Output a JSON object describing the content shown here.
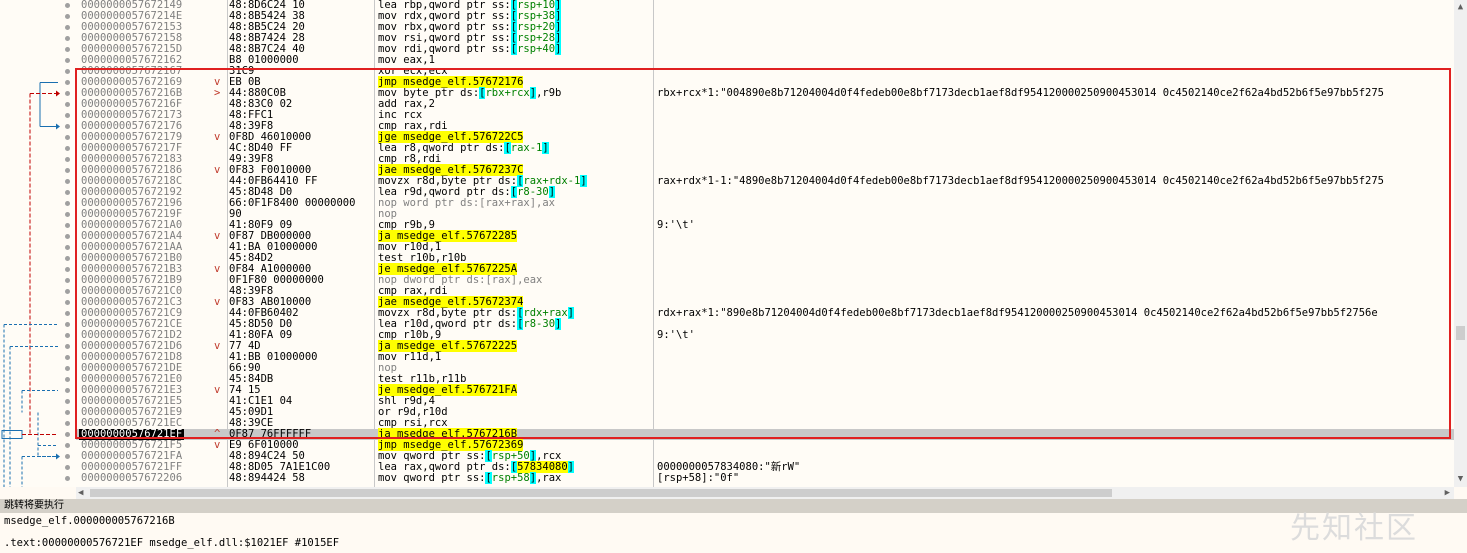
{
  "rows": [
    {
      "addr": "0000000057672149",
      "bytes": "48:8D6C24 10",
      "instr": [
        {
          "t": "lea rbp,qword ptr ss:"
        },
        {
          "t": "[",
          "c": "bracket"
        },
        {
          "t": "rsp+10",
          "c": "reg"
        },
        {
          "t": "]",
          "c": "bracket"
        }
      ],
      "comment": ""
    },
    {
      "addr": "000000005767214E",
      "bytes": "48:8B5424 38",
      "instr": [
        {
          "t": "mov rdx,qword ptr ss:"
        },
        {
          "t": "[",
          "c": "bracket"
        },
        {
          "t": "rsp+38",
          "c": "reg"
        },
        {
          "t": "]",
          "c": "bracket"
        }
      ],
      "comment": ""
    },
    {
      "addr": "0000000057672153",
      "bytes": "48:8B5C24 20",
      "instr": [
        {
          "t": "mov rbx,qword ptr ss:"
        },
        {
          "t": "[",
          "c": "bracket"
        },
        {
          "t": "rsp+20",
          "c": "reg"
        },
        {
          "t": "]",
          "c": "bracket"
        }
      ],
      "comment": ""
    },
    {
      "addr": "0000000057672158",
      "bytes": "48:8B7424 28",
      "instr": [
        {
          "t": "mov rsi,qword ptr ss:"
        },
        {
          "t": "[",
          "c": "bracket"
        },
        {
          "t": "rsp+28",
          "c": "reg"
        },
        {
          "t": "]",
          "c": "bracket"
        }
      ],
      "comment": ""
    },
    {
      "addr": "000000005767215D",
      "bytes": "48:8B7C24 40",
      "instr": [
        {
          "t": "mov rdi,qword ptr ss:"
        },
        {
          "t": "[",
          "c": "bracket"
        },
        {
          "t": "rsp+40",
          "c": "reg"
        },
        {
          "t": "]",
          "c": "bracket"
        }
      ],
      "comment": ""
    },
    {
      "addr": "0000000057672162",
      "bytes": "B8 01000000",
      "instr": [
        {
          "t": "mov eax,1"
        }
      ],
      "comment": ""
    },
    {
      "addr": "0000000057672167",
      "bytes": "31C9",
      "instr": [
        {
          "t": "xor ecx,ecx"
        }
      ],
      "comment": ""
    },
    {
      "addr": "0000000057672169",
      "flag": "v",
      "bytes": "EB 0B",
      "instr": [
        {
          "t": "jmp msedge_elf.57672176",
          "c": "jmp"
        }
      ],
      "comment": ""
    },
    {
      "addr": "000000005767216B",
      "flag": ">",
      "bytes": "44:880C0B",
      "instr": [
        {
          "t": "mov byte ptr ds:"
        },
        {
          "t": "[",
          "c": "bracket"
        },
        {
          "t": "rbx+rcx",
          "c": "reg"
        },
        {
          "t": "]",
          "c": "bracket"
        },
        {
          "t": ",r9b"
        }
      ],
      "comment": "rbx+rcx*1:\"004890e8b71204004d0f4fedeb00e8bf7173decb1aef8df954120000250900453014 0c4502140ce2f62a4bd52b6f5e97bb5f275"
    },
    {
      "addr": "000000005767216F",
      "bytes": "48:83C0 02",
      "instr": [
        {
          "t": "add rax,2"
        }
      ],
      "comment": ""
    },
    {
      "addr": "0000000057672173",
      "bytes": "48:FFC1",
      "instr": [
        {
          "t": "inc rcx"
        }
      ],
      "comment": ""
    },
    {
      "addr": "0000000057672176",
      "bytes": "48:39F8",
      "instr": [
        {
          "t": "cmp rax,rdi"
        }
      ],
      "comment": ""
    },
    {
      "addr": "0000000057672179",
      "flag": "v",
      "bytes": "0F8D 46010000",
      "instr": [
        {
          "t": "jge msedge_elf.576722C5",
          "c": "jmp"
        }
      ],
      "comment": ""
    },
    {
      "addr": "000000005767217F",
      "bytes": "4C:8D40 FF",
      "instr": [
        {
          "t": "lea r8,qword ptr ds:"
        },
        {
          "t": "[",
          "c": "bracket"
        },
        {
          "t": "rax-1",
          "c": "reg"
        },
        {
          "t": "]",
          "c": "bracket"
        }
      ],
      "comment": ""
    },
    {
      "addr": "0000000057672183",
      "bytes": "49:39F8",
      "instr": [
        {
          "t": "cmp r8,rdi"
        }
      ],
      "comment": ""
    },
    {
      "addr": "0000000057672186",
      "flag": "v",
      "bytes": "0F83 F0010000",
      "instr": [
        {
          "t": "jae msedge_elf.5767237C",
          "c": "jmp"
        }
      ],
      "comment": ""
    },
    {
      "addr": "000000005767218C",
      "bytes": "44:0FB64410 FF",
      "instr": [
        {
          "t": "movzx r8d,byte ptr ds:"
        },
        {
          "t": "[",
          "c": "bracket"
        },
        {
          "t": "rax+rdx-1",
          "c": "reg"
        },
        {
          "t": "]",
          "c": "bracket"
        }
      ],
      "comment": "rax+rdx*1-1:\"4890e8b71204004d0f4fedeb00e8bf7173decb1aef8df954120000250900453014 0c4502140ce2f62a4bd52b6f5e97bb5f275"
    },
    {
      "addr": "0000000057672192",
      "bytes": "45:8D48 D0",
      "instr": [
        {
          "t": "lea r9d,qword ptr ds:"
        },
        {
          "t": "[",
          "c": "bracket"
        },
        {
          "t": "r8-30",
          "c": "reg"
        },
        {
          "t": "]",
          "c": "bracket"
        }
      ],
      "comment": ""
    },
    {
      "addr": "0000000057672196",
      "bytes": "66:0F1F8400 00000000",
      "instr": [
        {
          "t": "nop word ptr ds:[rax+rax],ax",
          "c": "nop"
        }
      ],
      "comment": ""
    },
    {
      "addr": "000000005767219F",
      "bytes": "90",
      "instr": [
        {
          "t": "nop",
          "c": "nop"
        }
      ],
      "comment": ""
    },
    {
      "addr": "00000000576721A0",
      "bytes": "41:80F9 09",
      "instr": [
        {
          "t": "cmp r9b,9"
        }
      ],
      "comment": "9:'\\t'"
    },
    {
      "addr": "00000000576721A4",
      "flag": "v",
      "bytes": "0F87 DB000000",
      "instr": [
        {
          "t": "ja msedge_elf.57672285",
          "c": "jmp"
        }
      ],
      "comment": ""
    },
    {
      "addr": "00000000576721AA",
      "bytes": "41:BA 01000000",
      "instr": [
        {
          "t": "mov r10d,1"
        }
      ],
      "comment": ""
    },
    {
      "addr": "00000000576721B0",
      "bytes": "45:84D2",
      "instr": [
        {
          "t": "test r10b,r10b"
        }
      ],
      "comment": ""
    },
    {
      "addr": "00000000576721B3",
      "flag": "v",
      "bytes": "0F84 A1000000",
      "instr": [
        {
          "t": "je msedge_elf.5767225A",
          "c": "jmp"
        }
      ],
      "comment": ""
    },
    {
      "addr": "00000000576721B9",
      "bytes": "0F1F80 00000000",
      "instr": [
        {
          "t": "nop dword ptr ds:[rax],eax",
          "c": "nop"
        }
      ],
      "comment": ""
    },
    {
      "addr": "00000000576721C0",
      "bytes": "48:39F8",
      "instr": [
        {
          "t": "cmp rax,rdi"
        }
      ],
      "comment": ""
    },
    {
      "addr": "00000000576721C3",
      "flag": "v",
      "bytes": "0F83 AB010000",
      "instr": [
        {
          "t": "jae msedge_elf.57672374",
          "c": "jmp"
        }
      ],
      "comment": ""
    },
    {
      "addr": "00000000576721C9",
      "bytes": "44:0FB60402",
      "instr": [
        {
          "t": "movzx r8d,byte ptr ds:"
        },
        {
          "t": "[",
          "c": "bracket"
        },
        {
          "t": "rdx+rax",
          "c": "reg"
        },
        {
          "t": "]",
          "c": "bracket"
        }
      ],
      "comment": "rdx+rax*1:\"890e8b71204004d0f4fedeb00e8bf7173decb1aef8df954120000250900453014 0c4502140ce2f62a4bd52b6f5e97bb5f2756e"
    },
    {
      "addr": "00000000576721CE",
      "bytes": "45:8D50 D0",
      "instr": [
        {
          "t": "lea r10d,qword ptr ds:"
        },
        {
          "t": "[",
          "c": "bracket"
        },
        {
          "t": "r8-30",
          "c": "reg"
        },
        {
          "t": "]",
          "c": "bracket"
        }
      ],
      "comment": ""
    },
    {
      "addr": "00000000576721D2",
      "bytes": "41:80FA 09",
      "instr": [
        {
          "t": "cmp r10b,9"
        }
      ],
      "comment": "9:'\\t'"
    },
    {
      "addr": "00000000576721D6",
      "flag": "v",
      "bytes": "77 4D",
      "instr": [
        {
          "t": "ja msedge_elf.57672225",
          "c": "jmp"
        }
      ],
      "comment": ""
    },
    {
      "addr": "00000000576721D8",
      "bytes": "41:BB 01000000",
      "instr": [
        {
          "t": "mov r11d,1"
        }
      ],
      "comment": ""
    },
    {
      "addr": "00000000576721DE",
      "bytes": "66:90",
      "instr": [
        {
          "t": "nop",
          "c": "nop"
        }
      ],
      "comment": ""
    },
    {
      "addr": "00000000576721E0",
      "bytes": "45:84DB",
      "instr": [
        {
          "t": "test r11b,r11b"
        }
      ],
      "comment": ""
    },
    {
      "addr": "00000000576721E3",
      "flag": "v",
      "bytes": "74 15",
      "instr": [
        {
          "t": "je msedge_elf.576721FA",
          "c": "jmp"
        }
      ],
      "comment": ""
    },
    {
      "addr": "00000000576721E5",
      "bytes": "41:C1E1 04",
      "instr": [
        {
          "t": "shl r9d,4"
        }
      ],
      "comment": ""
    },
    {
      "addr": "00000000576721E9",
      "bytes": "45:09D1",
      "instr": [
        {
          "t": "or r9d,r10d"
        }
      ],
      "comment": ""
    },
    {
      "addr": "00000000576721EC",
      "bytes": "48:39CE",
      "instr": [
        {
          "t": "cmp rsi,rcx"
        }
      ],
      "comment": ""
    },
    {
      "addr": "00000000576721EF",
      "flag": "^",
      "current": true,
      "bytes": "0F87 76FFFFFF",
      "instr": [
        {
          "t": "ja msedge_elf.5767216B",
          "c": "jmp"
        }
      ],
      "comment": ""
    },
    {
      "addr": "00000000576721F5",
      "flag": "v",
      "bytes": "E9 6F010000",
      "instr": [
        {
          "t": "jmp msedge_elf.57672369",
          "c": "jmp"
        }
      ],
      "comment": ""
    },
    {
      "addr": "00000000576721FA",
      "bytes": "48:894C24 50",
      "instr": [
        {
          "t": "mov qword ptr ss:"
        },
        {
          "t": "[",
          "c": "bracket"
        },
        {
          "t": "rsp+50",
          "c": "reg"
        },
        {
          "t": "]",
          "c": "bracket"
        },
        {
          "t": ",rcx"
        }
      ],
      "comment": ""
    },
    {
      "addr": "00000000576721FF",
      "bytes": "48:8D05 7A1E1C00",
      "instr": [
        {
          "t": "lea rax,qword ptr ds:"
        },
        {
          "t": "[",
          "c": "bracket"
        },
        {
          "t": "57834080",
          "c": "addrref"
        },
        {
          "t": "]",
          "c": "bracket"
        }
      ],
      "comment": "0000000057834080:\"新rW\""
    },
    {
      "addr": "0000000057672206",
      "bytes": "48:894424 58",
      "instr": [
        {
          "t": "mov qword ptr ss:"
        },
        {
          "t": "[",
          "c": "bracket"
        },
        {
          "t": "rsp+58",
          "c": "reg"
        },
        {
          "t": "]",
          "c": "bracket"
        },
        {
          "t": ",rax"
        }
      ],
      "comment": "[rsp+58]:\"0f\""
    }
  ],
  "colors": {
    "jmp_highlight": "#ffff00",
    "bracket_bg": "#00ffff",
    "reg_text": "#008000",
    "addrref_bg": "#ffff00",
    "nop_text": "#808080",
    "redbox": "#e02020",
    "jump_arrow_active": "#c00000",
    "jump_arrow": "#1a6fb0"
  },
  "status": {
    "title": "跳转将要执行",
    "target": "msedge_elf.000000005767216B",
    "location": ".text:00000000576721EF msedge_elf.dll:$1021EF #1015EF"
  },
  "watermark": "先知社区"
}
